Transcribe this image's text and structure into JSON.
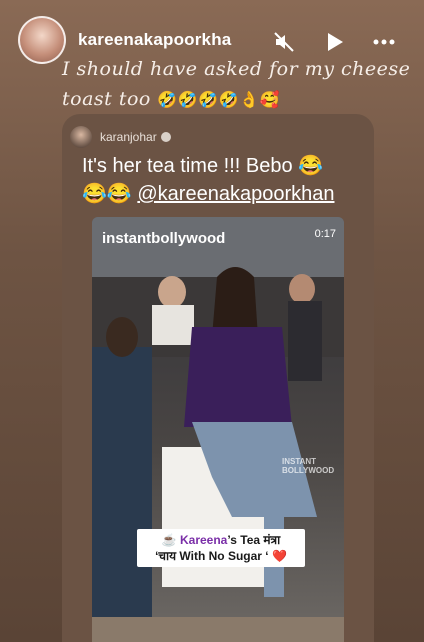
{
  "story": {
    "username": "kareenakapoorkha",
    "caption_text": "I should have asked for my cheese toast too",
    "caption_emojis": "🤣🤣🤣🤣👌🥰",
    "icons": {
      "mute": "mute-icon",
      "play": "play-icon",
      "more": "more-icon"
    }
  },
  "shared_post": {
    "author": "karanjohar",
    "text_line1": "It's her tea time !!! Bebo 😂",
    "text_line2_emoji": "😂😂",
    "mention": "@kareenakapoorkhan",
    "video": {
      "handle": "instantbollywood",
      "timestamp": "0:17",
      "watermark": "INSTANT BOLLYWOOD",
      "overlay_line1_prefix": "☕",
      "overlay_name": "Kareena",
      "overlay_line1_suffix": "’s Tea मंत्रा",
      "overlay_line2": "‘चाय With No Sugar ‘ ❤️"
    }
  },
  "colors": {
    "background": "#6e5443",
    "card": "#6b5344",
    "accent_name": "#7a2ea8"
  }
}
